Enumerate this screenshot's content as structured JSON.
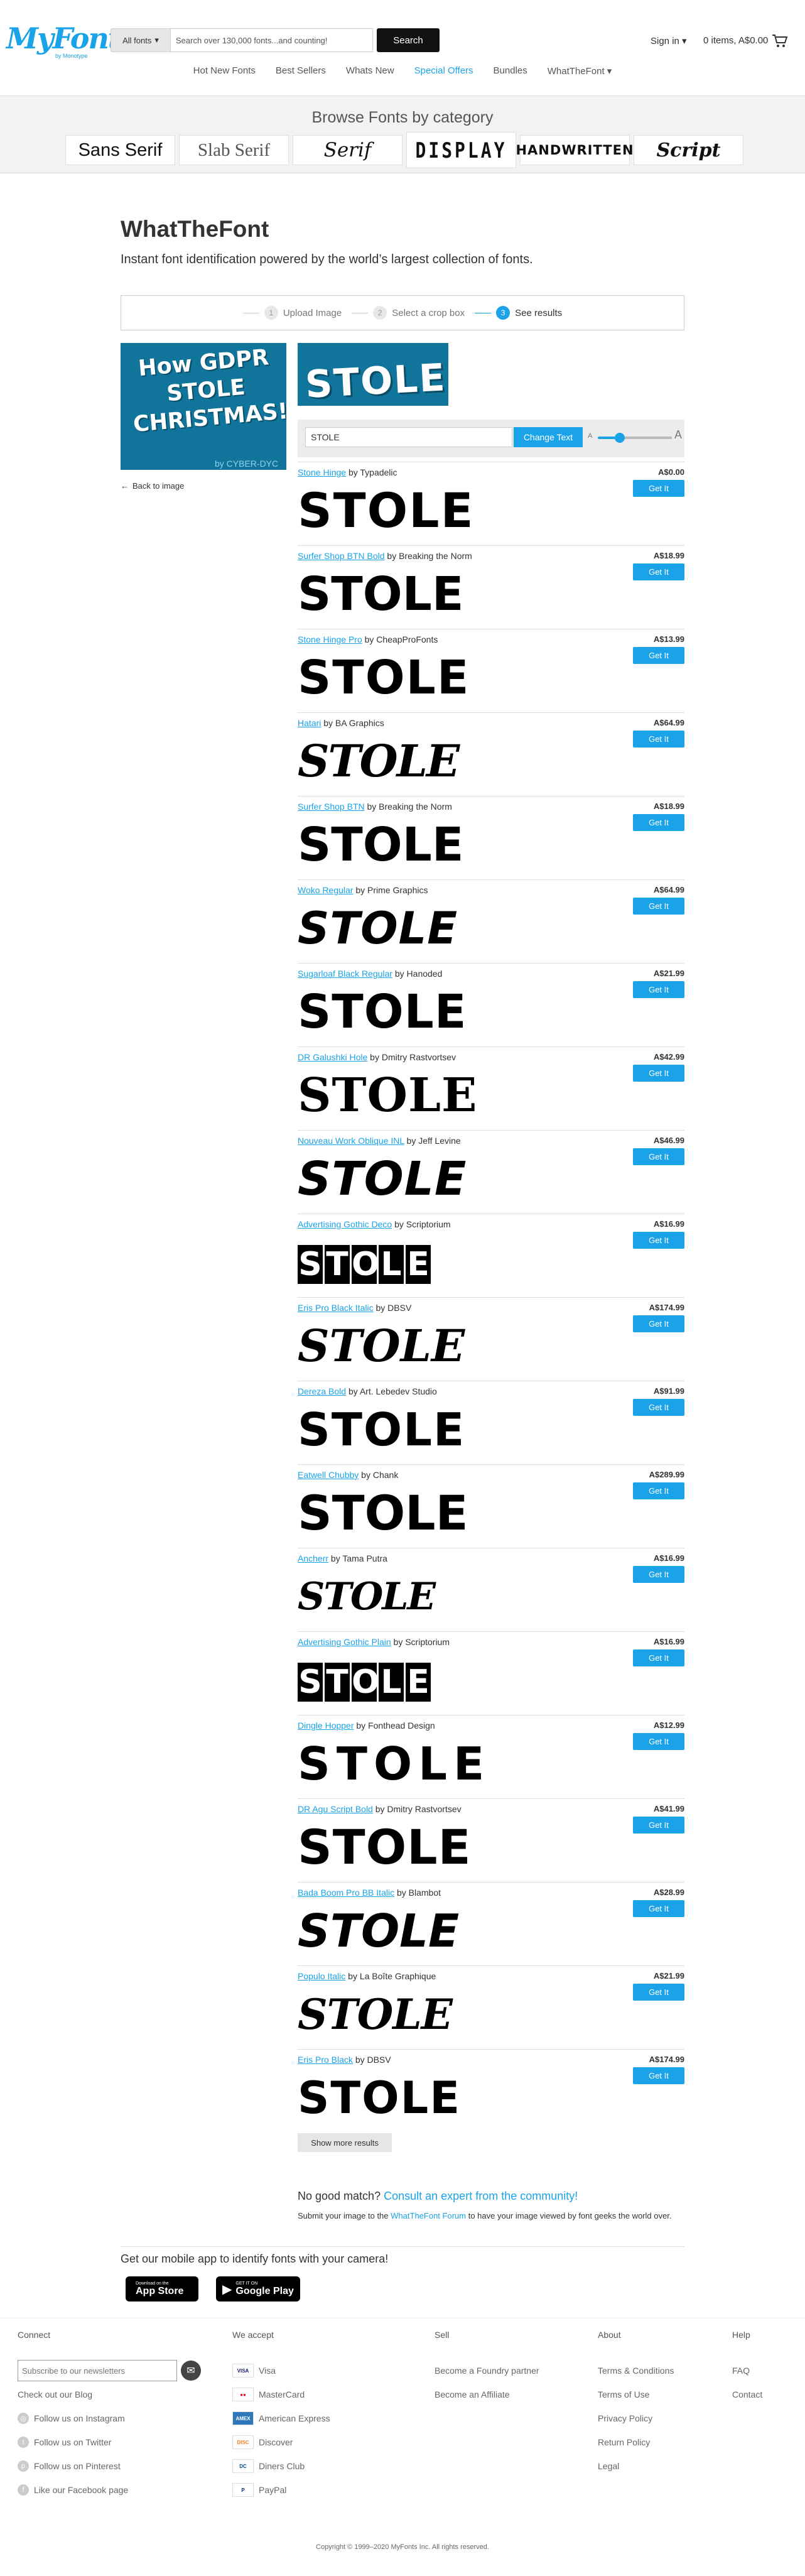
{
  "header": {
    "logo": "MyFonts",
    "logo_sub": "by Monotype",
    "fonts_select": "All fonts",
    "search_placeholder": "Search over 130,000 fonts...and counting!",
    "search_button": "Search",
    "signin": "Sign in",
    "cart": "0 items, A$0.00"
  },
  "nav": [
    {
      "label": "Hot New Fonts"
    },
    {
      "label": "Best Sellers"
    },
    {
      "label": "Whats New"
    },
    {
      "label": "Special Offers"
    },
    {
      "label": "Bundles"
    },
    {
      "label": "WhatTheFont"
    }
  ],
  "browse": {
    "title": "Browse Fonts by category",
    "categories": [
      "Sans Serif",
      "Slab Serif",
      "Serif",
      "DISPLAY",
      "HANDWRITTEN",
      "Script"
    ]
  },
  "main": {
    "title": "WhatTheFont",
    "subtitle": "Instant font identification powered by the world’s largest collection of fonts.",
    "steps": [
      {
        "num": "1",
        "label": "Upload Image"
      },
      {
        "num": "2",
        "label": "Select a crop box"
      },
      {
        "num": "3",
        "label": "See results"
      }
    ],
    "thumb_text": "How GDPR STOLE CHRISTMAS!",
    "thumb_foot": "by CYBER-DYC",
    "crop_text": "STOLE",
    "back_link": "Back to image",
    "sample_text": "STOLE",
    "change_text": "Change Text",
    "size_small": "A",
    "size_large": "A",
    "size_level": 0.3,
    "get_it": "Get It",
    "show_more": "Show more results",
    "nomatch_title": "No good match?",
    "nomatch_link": "Consult an expert from the community!",
    "nomatch_sub_pre": "Submit your image to the",
    "nomatch_sub_link": "WhatTheFont Forum",
    "nomatch_sub_post": "to have your image viewed by font geeks the world over.",
    "app_title": "Get our mobile app to identify fonts with your camera!",
    "appstore_small": "Download on the",
    "appstore_big": "App Store",
    "play_small": "GET IT ON",
    "play_big": "Google Play"
  },
  "results": [
    {
      "name": "Stone Hinge",
      "by": "by Typadelic",
      "price": "A$0.00"
    },
    {
      "name": "Surfer Shop BTN Bold",
      "by": "by Breaking the Norm",
      "price": "A$18.99"
    },
    {
      "name": "Stone Hinge Pro",
      "by": "by CheapProFonts",
      "price": "A$13.99"
    },
    {
      "name": "Hatari",
      "by": "by BA Graphics",
      "price": "A$64.99"
    },
    {
      "name": "Surfer Shop BTN",
      "by": "by Breaking the Norm",
      "price": "A$18.99"
    },
    {
      "name": "Woko Regular",
      "by": "by Prime Graphics",
      "price": "A$64.99"
    },
    {
      "name": "Sugarloaf Black Regular",
      "by": "by Hanoded",
      "price": "A$21.99"
    },
    {
      "name": "DR Galushki Hole",
      "by": "by Dmitry Rastvortsev",
      "price": "A$42.99"
    },
    {
      "name": "Nouveau Work Oblique INL",
      "by": "by Jeff Levine",
      "price": "A$46.99"
    },
    {
      "name": "Advertising Gothic Deco",
      "by": "by Scriptorium",
      "price": "A$16.99"
    },
    {
      "name": "Eris Pro Black Italic",
      "by": "by DBSV",
      "price": "A$174.99"
    },
    {
      "name": "Dereza Bold",
      "by": "by Art. Lebedev Studio",
      "price": "A$91.99"
    },
    {
      "name": "Eatwell Chubby",
      "by": "by Chank",
      "price": "A$289.99"
    },
    {
      "name": "Ancherr",
      "by": "by Tama Putra",
      "price": "A$16.99"
    },
    {
      "name": "Advertising Gothic Plain",
      "by": "by Scriptorium",
      "price": "A$16.99"
    },
    {
      "name": "Dingle Hopper",
      "by": "by Fonthead Design",
      "price": "A$12.99"
    },
    {
      "name": "DR Agu Script Bold",
      "by": "by Dmitry Rastvortsev",
      "price": "A$41.99"
    },
    {
      "name": "Bada Boom Pro BB Italic",
      "by": "by Blambot",
      "price": "A$28.99"
    },
    {
      "name": "Populo Italic",
      "by": "by La Boîte Graphique",
      "price": "A$21.99"
    },
    {
      "name": "Eris Pro Black",
      "by": "by DBSV",
      "price": "A$174.99"
    }
  ],
  "footer": {
    "connect": "Connect",
    "newsletter_placeholder": "Subscribe to our newsletters",
    "social": [
      "Check out our Blog",
      "Follow us on Instagram",
      "Follow us on Twitter",
      "Follow us on Pinterest",
      "Like our Facebook page"
    ],
    "accept": "We accept",
    "payments": [
      "Visa",
      "MasterCard",
      "American Express",
      "Discover",
      "Diners Club",
      "PayPal"
    ],
    "sell": "Sell",
    "sell_items": [
      "Become a Foundry partner",
      "Become an Affiliate"
    ],
    "about": "About",
    "about_items": [
      "Terms & Conditions",
      "Terms of Use",
      "Privacy Policy",
      "Return Policy",
      "Legal"
    ],
    "help": "Help",
    "help_items": [
      "FAQ",
      "Contact"
    ],
    "copyright": "Copyright © 1999–2020 MyFonts Inc. All rights reserved."
  },
  "colors": {
    "accent": "#1aa3e8",
    "dark": "#111111",
    "thumb_bg": "#11749a"
  }
}
